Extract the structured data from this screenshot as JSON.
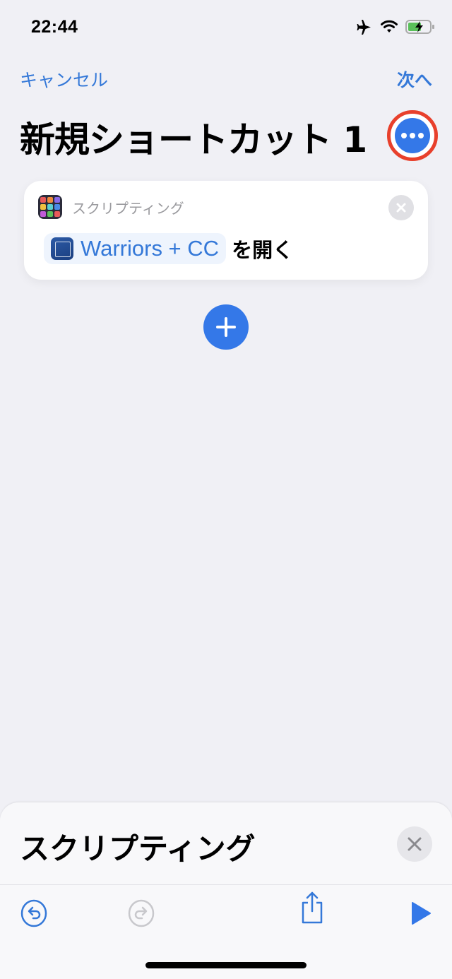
{
  "status_bar": {
    "time": "22:44",
    "icons": [
      "airplane-mode-icon",
      "wifi-icon",
      "battery-charging-icon"
    ]
  },
  "nav": {
    "cancel_label": "キャンセル",
    "next_label": "次へ"
  },
  "header": {
    "title": "新規ショートカット 1",
    "more_icon": "ellipsis-circle-icon"
  },
  "action_card": {
    "category": "スクリプティング",
    "app_name": "Warriors + CC",
    "verb": "を開く",
    "remove_icon": "close-circle-icon"
  },
  "add_action": {
    "icon": "plus-icon"
  },
  "bottom_sheet": {
    "title": "スクリプティング",
    "close_icon": "close-icon"
  },
  "toolbar": {
    "items": [
      {
        "name": "undo",
        "icon": "undo-icon",
        "enabled": true
      },
      {
        "name": "redo",
        "icon": "redo-icon",
        "enabled": false
      },
      {
        "name": "share",
        "icon": "share-icon",
        "enabled": true
      },
      {
        "name": "run",
        "icon": "play-icon",
        "enabled": true
      }
    ]
  },
  "colors": {
    "accent": "#3478e8",
    "highlight_ring": "#e8402c",
    "background": "#f0f0f5",
    "battery_fill": "#5ac05a"
  }
}
